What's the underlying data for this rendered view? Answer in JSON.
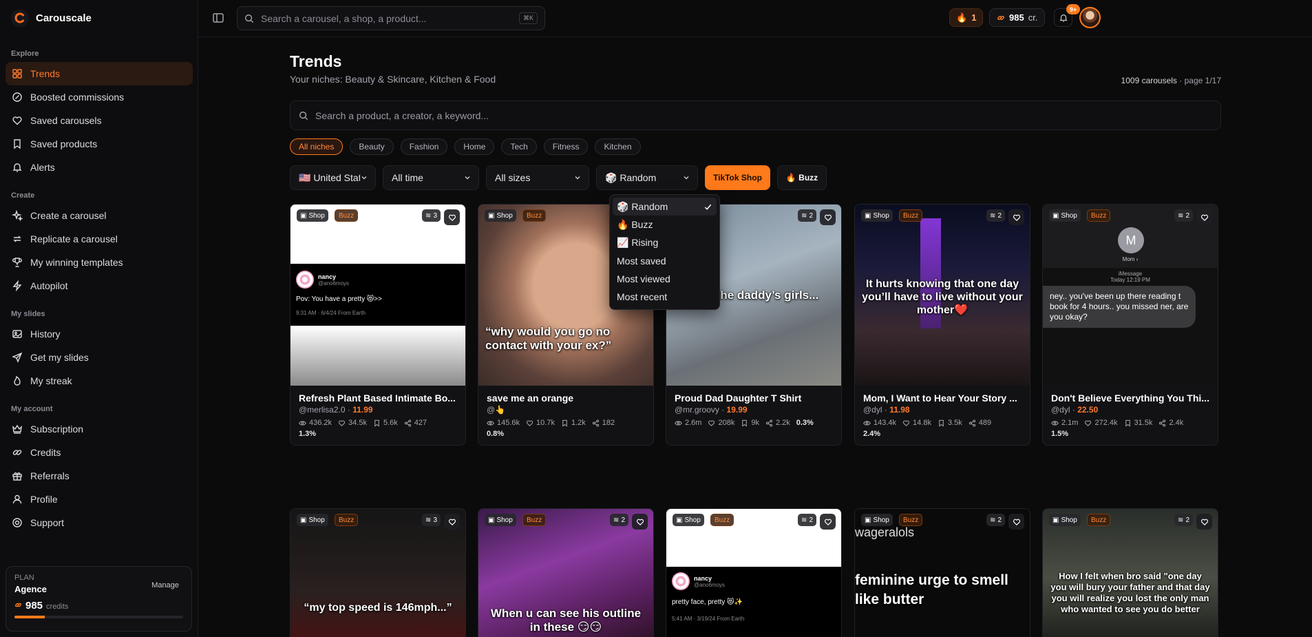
{
  "brand": {
    "name": "Carouscale"
  },
  "sidebar": {
    "sections": [
      {
        "title": "Explore",
        "items": [
          "Trends",
          "Boosted commissions",
          "Saved carousels",
          "Saved products",
          "Alerts"
        ]
      },
      {
        "title": "Create",
        "items": [
          "Create a carousel",
          "Replicate a carousel",
          "My winning templates",
          "Autopilot"
        ]
      },
      {
        "title": "My slides",
        "items": [
          "History",
          "Get my slides",
          "My streak"
        ]
      },
      {
        "title": "My account",
        "items": [
          "Subscription",
          "Credits",
          "Referrals",
          "Profile",
          "Support"
        ]
      }
    ],
    "plan": {
      "label": "PLAN",
      "name": "Agence",
      "manage": "Manage",
      "credits": "985",
      "credits_unit": "credits",
      "progress": 0.18
    }
  },
  "topbar": {
    "search_placeholder": "Search a carousel, a shop, a product...",
    "shortcut": "⌘K",
    "streak": "1",
    "credits": "985",
    "credits_unit": "cr.",
    "notifications": "9+"
  },
  "page": {
    "title": "Trends",
    "subtitle": "Your niches: Beauty & Skincare, Kitchen & Food",
    "count": "1009 carousels",
    "page_info": "· page 1/17",
    "search_placeholder": "Search a product, a creator, a keyword..."
  },
  "niches": [
    "All niches",
    "Beauty",
    "Fashion",
    "Home",
    "Tech",
    "Fitness",
    "Kitchen"
  ],
  "filters": {
    "country": "🇺🇸 United States",
    "time": "All time",
    "sizes": "All sizes",
    "sort": "🎲 Random",
    "tiktok_shop": "TikTok Shop",
    "buzz": "🔥 Buzz"
  },
  "sort_options": [
    "🎲 Random",
    "🔥 Buzz",
    "📈 Rising",
    "Most saved",
    "Most viewed",
    "Most recent"
  ],
  "badges": {
    "shop": "Shop",
    "buzz": "Buzz"
  },
  "cards": [
    {
      "title": "Refresh Plant Based Intimate Bo...",
      "creator": "@merlisa2.0",
      "price": "11.99",
      "views": "436.2k",
      "likes": "34.5k",
      "saves": "5.6k",
      "shares": "427",
      "rate": "1.3%",
      "count": "3",
      "tweet": {
        "name": "nancy",
        "handle": "@ano6moys",
        "text": "Pov: You have a pretty 😻>>",
        "meta": "9:31 AM · 6/4/24 From Earth"
      }
    },
    {
      "title": "save me an orange",
      "creator": "@👆",
      "price": "",
      "views": "145.6k",
      "likes": "10.7k",
      "saves": "1.2k",
      "shares": "182",
      "rate": "0.8%",
      "count": "",
      "caption": "“why would you go no contact with your ex?”"
    },
    {
      "title": "Proud Dad Daughter T Shirt",
      "creator": "@mr.groovy",
      "price": "19.99",
      "views": "2.6m",
      "likes": "208k",
      "saves": "9k",
      "shares": "2.2k",
      "rate": "0.3%",
      "count": "2",
      "caption": "the daddy’s girls..."
    },
    {
      "title": "Mom, I Want to Hear Your Story ...",
      "creator": "@dyl",
      "price": "11.98",
      "views": "143.4k",
      "likes": "14.8k",
      "saves": "3.5k",
      "shares": "489",
      "rate": "2.4%",
      "count": "2",
      "caption": "It hurts knowing that one day you’ll have to live without your mother❤️"
    },
    {
      "title": "Don't Believe Everything You Thi...",
      "creator": "@dyl",
      "price": "22.50",
      "views": "2.1m",
      "likes": "272.4k",
      "saves": "31.5k",
      "shares": "2.4k",
      "rate": "1.5%",
      "count": "2",
      "imessage": {
        "initial": "M",
        "contact": "Mom ›",
        "service": "iMessage",
        "time": "Today 12:19 PM",
        "text": "ney.. you've been up there reading t book for 4 hours.. you missed ner, are you okay?"
      }
    },
    {
      "count": "3",
      "caption": "“my top speed is 146mph...”"
    },
    {
      "count": "2",
      "caption": "When u can see his outline in these 😏😏"
    },
    {
      "count": "2",
      "tweet": {
        "name": "nancy",
        "handle": "@ano6moys",
        "text": "pretty face, pretty 😻✨",
        "meta": "5:41 AM · 3/19/24 From Earth"
      }
    },
    {
      "count": "2",
      "top_text": "wageralols",
      "caption": "feminine urge to smell like butter"
    },
    {
      "count": "2",
      "caption": "How I felt when bro said \"one day you will bury your father and that day you will realize you lost the only man who wanted to see you do better"
    }
  ],
  "colors": {
    "accent": "#ff7a1a",
    "background": "#0b0b0c"
  }
}
